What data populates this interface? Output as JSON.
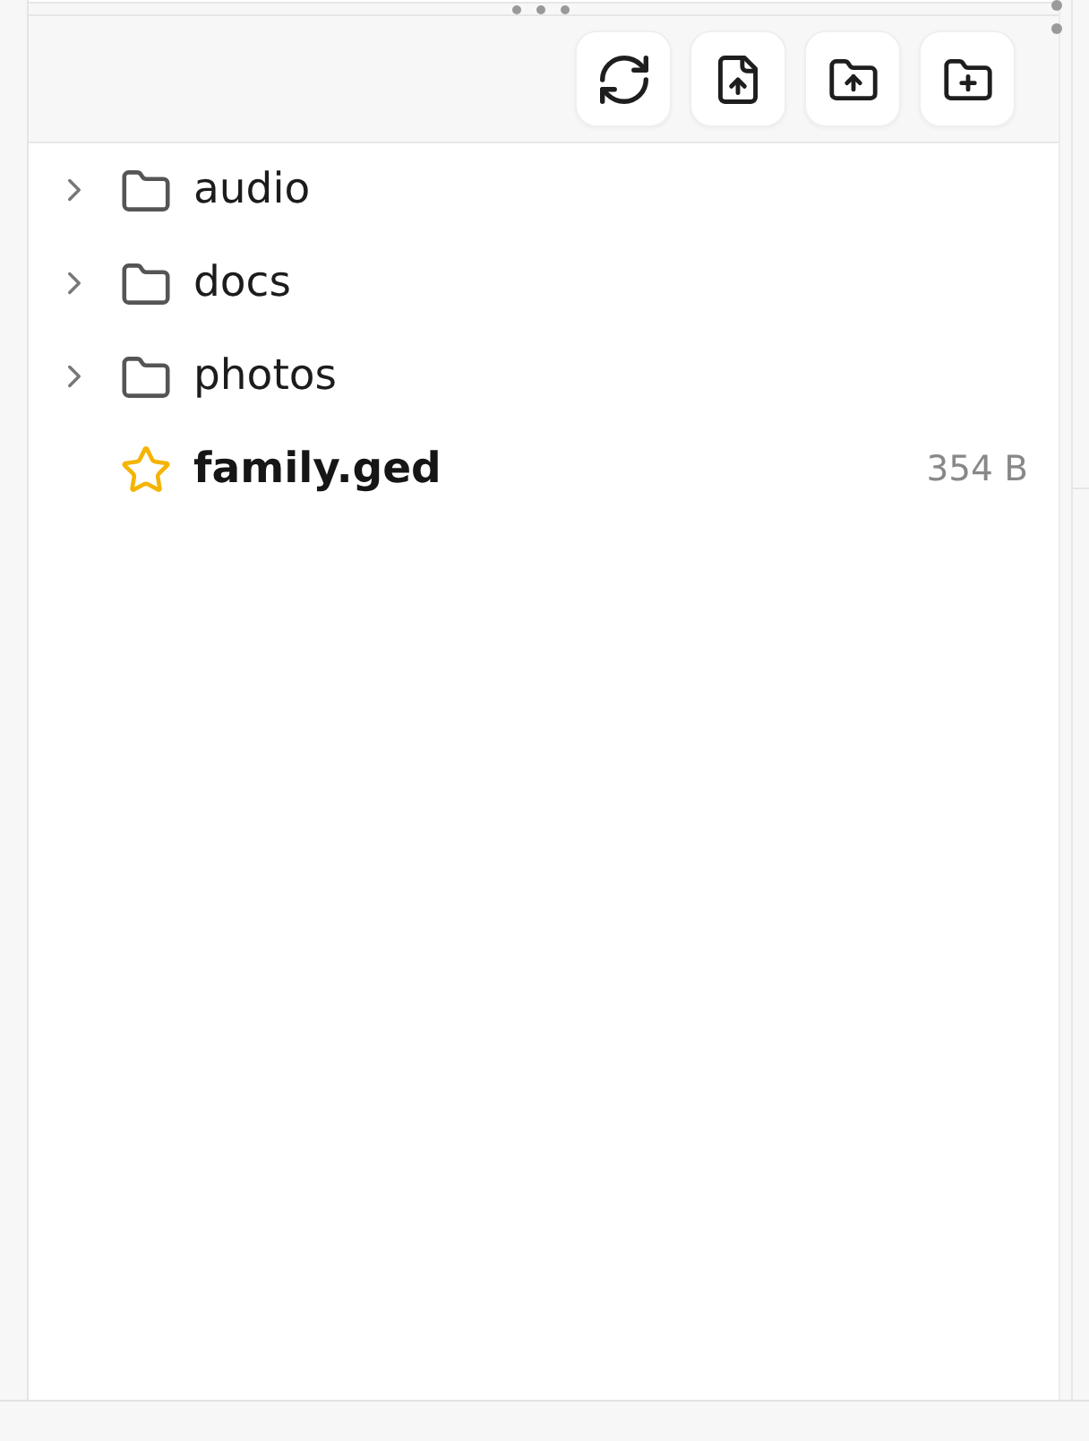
{
  "file_list": {
    "items": [
      {
        "kind": "folder",
        "name": "audio",
        "expanded": false
      },
      {
        "kind": "folder",
        "name": "docs",
        "expanded": false
      },
      {
        "kind": "folder",
        "name": "photos",
        "expanded": false
      },
      {
        "kind": "file",
        "name": "family.ged",
        "size": "354 B"
      }
    ]
  }
}
